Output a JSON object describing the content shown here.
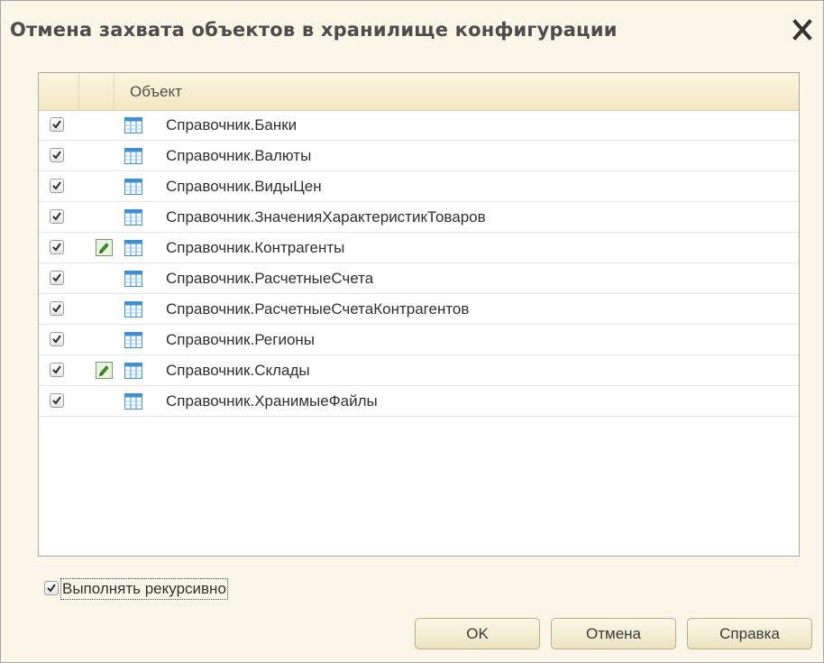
{
  "window": {
    "title": "Отмена захвата объектов в хранилище конфигурации",
    "close_icon": "close-icon"
  },
  "grid": {
    "column_header": "Объект",
    "rows": [
      {
        "label": "Справочник.Банки",
        "checked": true,
        "edit_icon": false
      },
      {
        "label": "Справочник.Валюты",
        "checked": true,
        "edit_icon": false
      },
      {
        "label": "Справочник.ВидыЦен",
        "checked": true,
        "edit_icon": false
      },
      {
        "label": "Справочник.ЗначенияХарактеристикТоваров",
        "checked": true,
        "edit_icon": false
      },
      {
        "label": "Справочник.Контрагенты",
        "checked": true,
        "edit_icon": true
      },
      {
        "label": "Справочник.РасчетныеСчета",
        "checked": true,
        "edit_icon": false
      },
      {
        "label": "Справочник.РасчетныеСчетаКонтрагентов",
        "checked": true,
        "edit_icon": false
      },
      {
        "label": "Справочник.Регионы",
        "checked": true,
        "edit_icon": false
      },
      {
        "label": "Справочник.Склады",
        "checked": true,
        "edit_icon": true
      },
      {
        "label": "Справочник.ХранимыеФайлы",
        "checked": true,
        "edit_icon": false
      }
    ]
  },
  "options": {
    "recursive_label": "Выполнять рекурсивно",
    "recursive_checked": true
  },
  "buttons": {
    "ok_label": "OK",
    "cancel_label": "Отмена",
    "help_label": "Справка"
  },
  "colors": {
    "window_bg": "#fbf7e8",
    "header_bg": "#f2e7c0",
    "catalog_icon": "#3f8fd0"
  }
}
